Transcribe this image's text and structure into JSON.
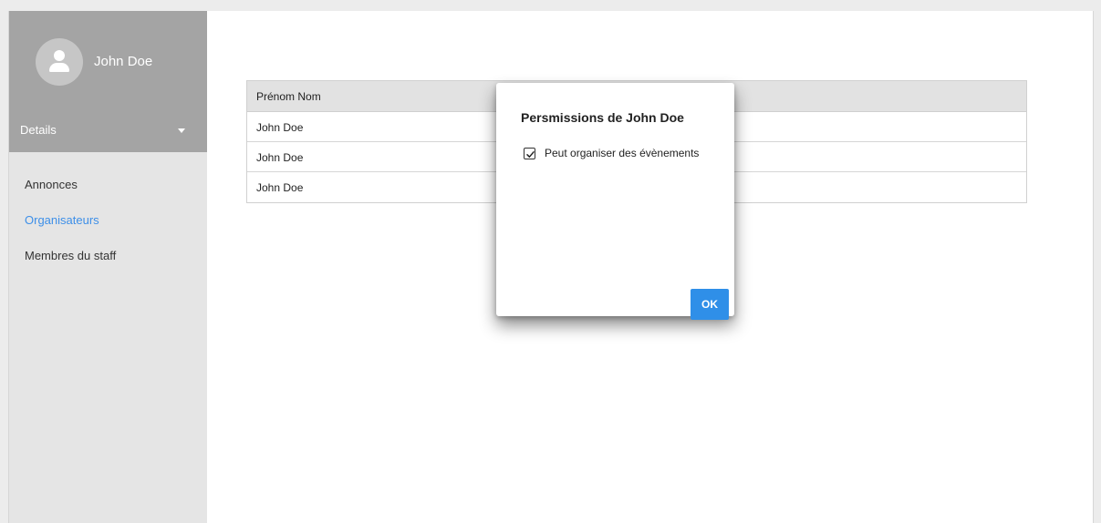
{
  "sidebar": {
    "user_name": "John Doe",
    "avatar_icon": "person-icon",
    "details_label": "Details",
    "details_icon": "caret-down-icon",
    "nav_items": [
      {
        "label": "Annonces",
        "active": false
      },
      {
        "label": "Organisateurs",
        "active": true
      },
      {
        "label": "Membres du staff",
        "active": false
      }
    ],
    "active_color": "#3d8fe8"
  },
  "table": {
    "header": "Prénom Nom",
    "rows": [
      "John Doe",
      "John Doe",
      "John Doe"
    ]
  },
  "dialog": {
    "title": "Persmissions de John Doe",
    "permissions": [
      {
        "label": "Peut organiser des évènements",
        "checked": true,
        "icon": "checkbox-checked-icon"
      }
    ],
    "ok_label": "OK",
    "ok_color": "#2f8fe8"
  }
}
